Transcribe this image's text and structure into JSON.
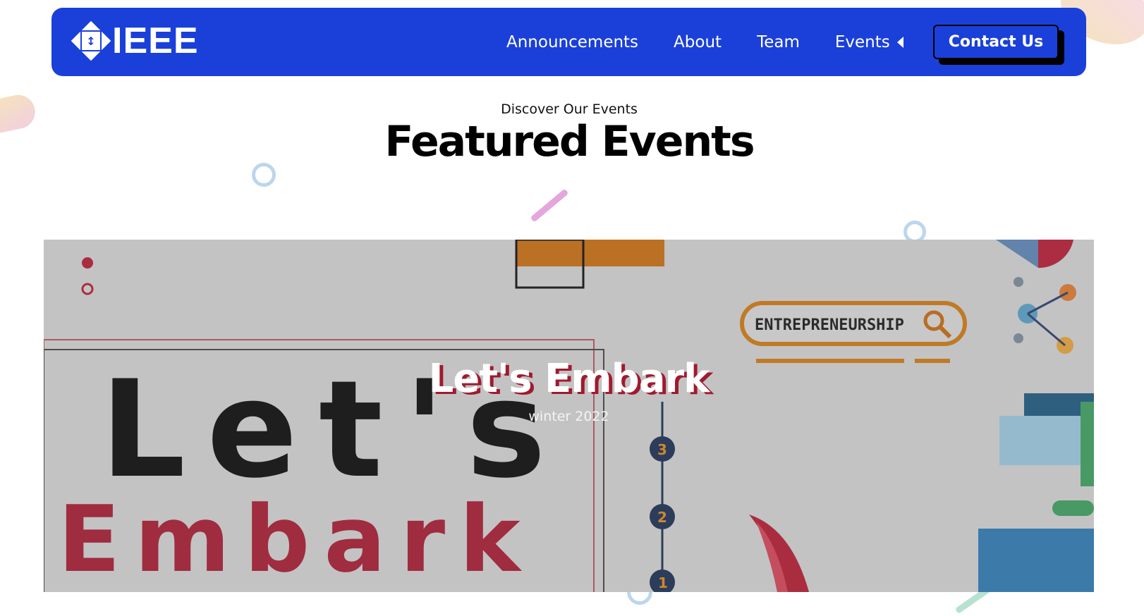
{
  "brand": {
    "logo_text": "IEEE",
    "primary_color": "#1a40d9"
  },
  "nav": {
    "items": [
      {
        "label": "Announcements"
      },
      {
        "label": "About"
      },
      {
        "label": "Team"
      },
      {
        "label": "Events"
      }
    ],
    "contact_label": "Contact Us"
  },
  "section": {
    "eyebrow": "Discover Our Events",
    "title": "Featured Events"
  },
  "event": {
    "title": "Let's Embark",
    "subtitle": "winter 2022",
    "art": {
      "word_top": "Let's",
      "word_bottom": "Embark",
      "search_label": "ENTREPRENEURSHIP",
      "steps": [
        "3",
        "2",
        "1"
      ]
    }
  }
}
